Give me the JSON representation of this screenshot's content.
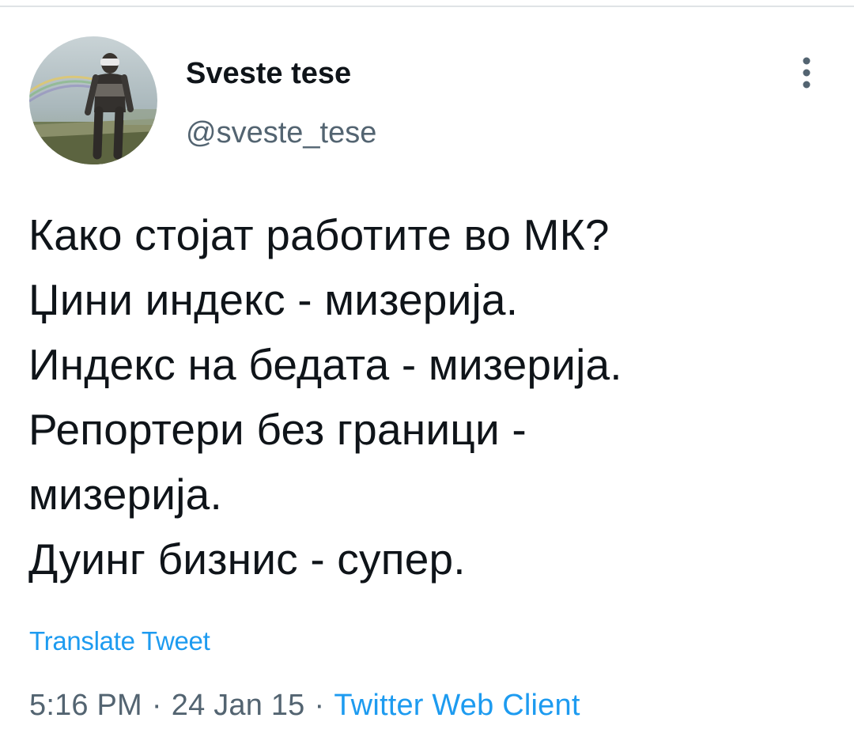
{
  "tweet": {
    "display_name": "Sveste tese",
    "handle": "@sveste_tese",
    "text_lines": [
      "Како стојат работите во МК?",
      "Џини индекс - мизерија.",
      "Индекс на бедата - мизерија.",
      "Репортери без граници -",
      "мизерија.",
      "Дуинг бизнис - супер."
    ],
    "translate_label": "Translate Tweet",
    "time": "5:16 PM",
    "separator": "·",
    "date": "24 Jan 15",
    "source": "Twitter Web Client"
  },
  "icons": {
    "more": "more-vertical-icon",
    "avatar": "avatar-photo"
  },
  "colors": {
    "text": "#0f1419",
    "secondary": "#536471",
    "accent": "#1d9bf0",
    "divider": "#dfe3e6"
  }
}
